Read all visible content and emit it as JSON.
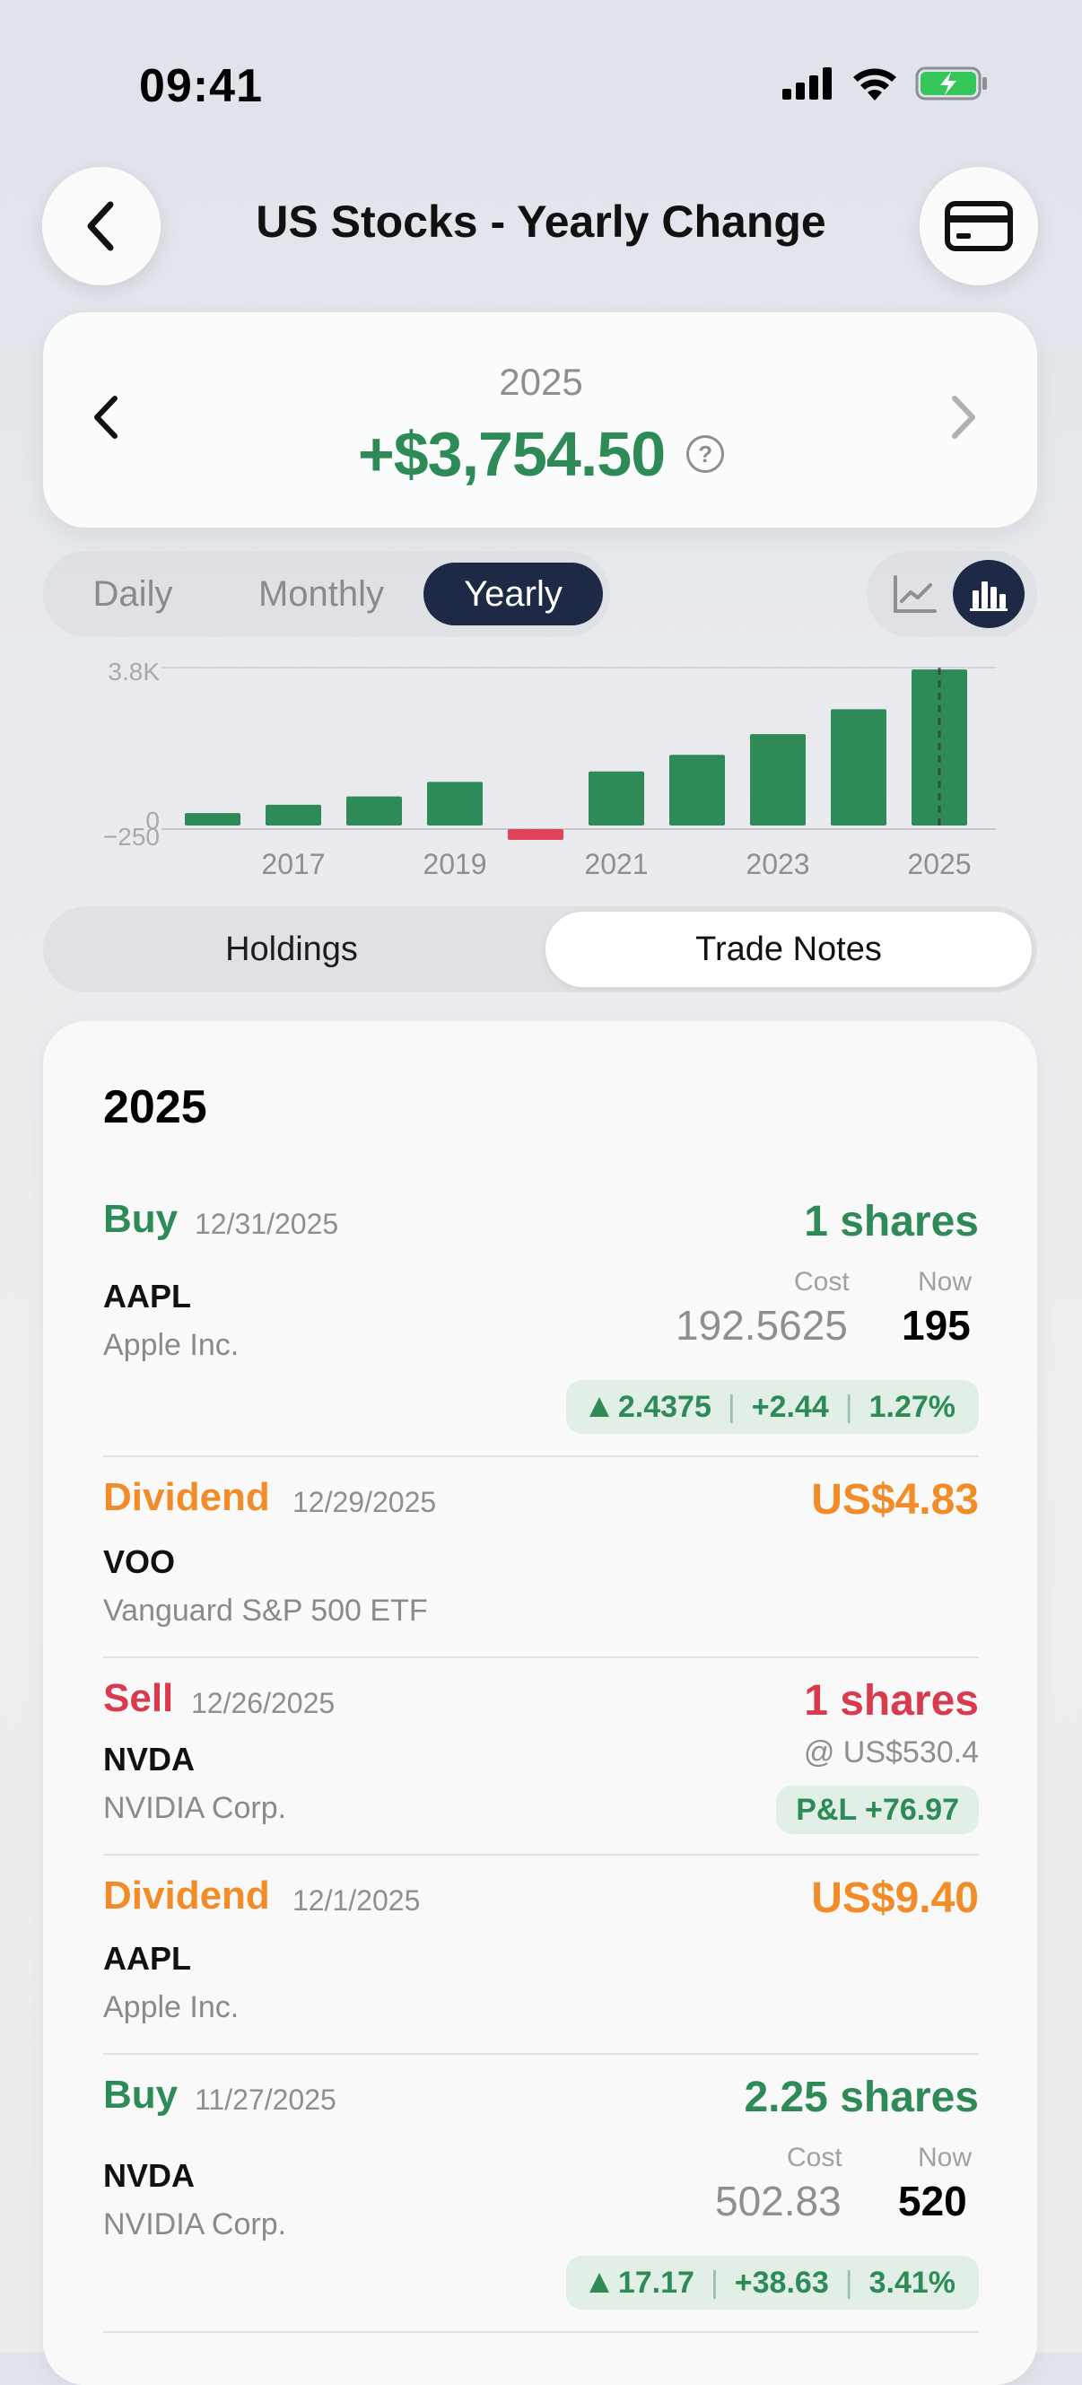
{
  "status": {
    "time": "09:41"
  },
  "header": {
    "title": "US Stocks - Yearly Change"
  },
  "summary": {
    "year": "2025",
    "amount": "+$3,754.50",
    "help": "?"
  },
  "period_tabs": {
    "daily": "Daily",
    "monthly": "Monthly",
    "yearly": "Yearly",
    "selected": "Yearly"
  },
  "chart_view": {
    "selected": "bar"
  },
  "chart_data": {
    "type": "bar",
    "categories": [
      "2016",
      "2017",
      "2018",
      "2019",
      "2020",
      "2021",
      "2022",
      "2023",
      "2024",
      "2025"
    ],
    "values": [
      300,
      500,
      700,
      1050,
      -250,
      1300,
      1700,
      2200,
      2800,
      3754.5
    ],
    "y_tick_labels": [
      "3.8K",
      "0",
      "−250"
    ],
    "x_tick_labels": [
      "2017",
      "2019",
      "2021",
      "2023",
      "2025"
    ],
    "ylim": [
      -250,
      3800
    ],
    "highlight": "2025",
    "colors": {
      "positive": "#2e8b57",
      "negative": "#e04458"
    }
  },
  "tabs": {
    "holdings": "Holdings",
    "notes": "Trade Notes",
    "selected": "Trade Notes"
  },
  "list": {
    "year": "2025",
    "cost_label": "Cost",
    "now_label": "Now",
    "items": [
      {
        "type": "Buy",
        "date": "12/31/2025",
        "ticker": "AAPL",
        "company": "Apple Inc.",
        "qty": "1 shares",
        "cost": "192.5625",
        "now": "195",
        "chg": "2.4375",
        "pnl": "+2.44",
        "pct": "1.27%"
      },
      {
        "type": "Dividend",
        "date": "12/29/2025",
        "ticker": "VOO",
        "company": "Vanguard S&P 500 ETF",
        "amount": "US$4.83"
      },
      {
        "type": "Sell",
        "date": "12/26/2025",
        "ticker": "NVDA",
        "company": "NVIDIA Corp.",
        "qty": "1 shares",
        "price": "@ US$530.4",
        "pnl": "P&L +76.97"
      },
      {
        "type": "Dividend",
        "date": "12/1/2025",
        "ticker": "AAPL",
        "company": "Apple Inc.",
        "amount": "US$9.40"
      },
      {
        "type": "Buy",
        "date": "11/27/2025",
        "ticker": "NVDA",
        "company": "NVIDIA Corp.",
        "qty": "2.25 shares",
        "cost": "502.83",
        "now": "520",
        "chg": "17.17",
        "pnl": "+38.63",
        "pct": "3.41%"
      }
    ]
  },
  "colors": {
    "buy": "#2e8b57",
    "dividend": "#f28c28",
    "sell": "#d93a4e",
    "accent_dark": "#1e2a45"
  }
}
